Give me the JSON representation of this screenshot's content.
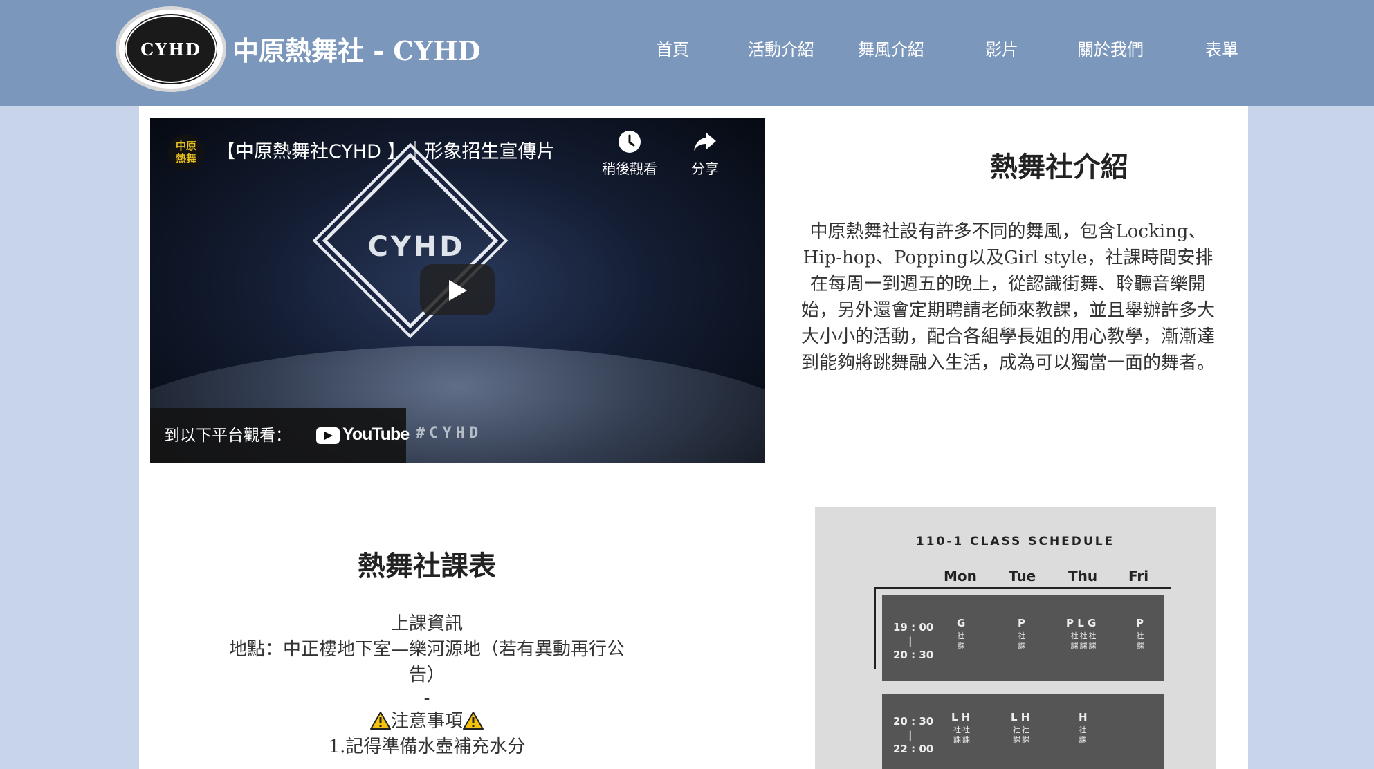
{
  "header": {
    "logo_text": "CYHD",
    "site_title": "中原熱舞社 - CYHD",
    "nav": [
      "首頁",
      "活動介紹",
      "舞風介紹",
      "影片",
      "關於我們",
      "表單"
    ]
  },
  "video": {
    "channel_badge": "中原熱舞",
    "title": "【中原熱舞社CYHD 】｜形象招生宣傳片",
    "watch_later": "稍後觀看",
    "share": "分享",
    "watch_on": "到以下平台觀看：",
    "youtube": "YouTube",
    "hashtag": "#CYHD",
    "logo_mark": "CYHD"
  },
  "intro": {
    "title": "熱舞社介紹",
    "body": "中原熱舞社設有許多不同的舞風，包含Locking、Hip-hop、Popping以及Girl style，社課時間安排在每周一到週五的晚上，從認識街舞、聆聽音樂開始，另外還會定期聘請老師來教課，並且舉辦許多大大小小的活動，配合各組學長姐的用心教學，漸漸達到能夠將跳舞融入生活，成為可以獨當一面的舞者。"
  },
  "schedule": {
    "title": "熱舞社課表",
    "info_heading": "上課資訊",
    "location": "地點：中正樓地下室—樂河源地（若有異動再行公告）",
    "dash": "-",
    "notice": "注意事項",
    "rule1": "1.記得準備水壺補充水分"
  },
  "schedule_image": {
    "title": "110-1 CLASS SCHEDULE",
    "days": [
      "Mon",
      "Tue",
      "Thu",
      "Fri"
    ],
    "slots": [
      {
        "time_start": "19 : 00",
        "sep": "|",
        "time_end": "20 : 30",
        "cells": [
          "G",
          "P",
          "P L G",
          "P"
        ],
        "subs": [
          "社 課",
          "社 課",
          "社社社 課課課",
          "社 課"
        ]
      },
      {
        "time_start": "20 : 30",
        "sep": "|",
        "time_end": "22 : 00",
        "cells": [
          "L H",
          "L H",
          "H",
          ""
        ],
        "subs": [
          "社社 課課",
          "社社 課課",
          "社 課",
          ""
        ]
      }
    ]
  },
  "colors": {
    "header_bg": "#7b97bc",
    "page_bg": "#c7d4ea",
    "content_bg": "#ffffff"
  }
}
